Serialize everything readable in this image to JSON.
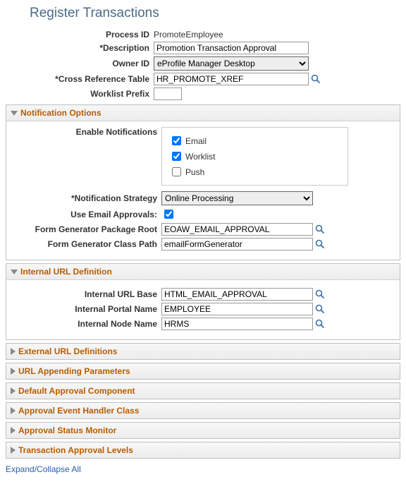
{
  "page_title": "Register Transactions",
  "top": {
    "process_id_label": "Process ID",
    "process_id_value": "PromoteEmployee",
    "description_label": "*Description",
    "description_value": "Promotion Transaction Approval",
    "owner_id_label": "Owner ID",
    "owner_id_value": "eProfile Manager Desktop",
    "xref_label": "*Cross Reference Table",
    "xref_value": "HR_PROMOTE_XREF",
    "worklist_prefix_label": "Worklist Prefix",
    "worklist_prefix_value": ""
  },
  "sections": {
    "notification": {
      "title": "Notification Options",
      "enable_label": "Enable Notifications",
      "email_label": "Email",
      "worklist_label": "Worklist",
      "push_label": "Push",
      "strategy_label": "*Notification Strategy",
      "strategy_value": "Online Processing",
      "use_email_label": "Use Email Approvals:",
      "pkg_root_label": "Form Generator Package Root",
      "pkg_root_value": "EOAW_EMAIL_APPROVAL",
      "class_path_label": "Form Generator Class Path",
      "class_path_value": "emailFormGenerator"
    },
    "internal_url": {
      "title": "Internal URL Definition",
      "base_label": "Internal URL Base",
      "base_value": "HTML_EMAIL_APPROVAL",
      "portal_label": "Internal Portal Name",
      "portal_value": "EMPLOYEE",
      "node_label": "Internal Node Name",
      "node_value": "HRMS"
    },
    "external_url": {
      "title": "External URL Definitions"
    },
    "url_append": {
      "title": "URL Appending Parameters"
    },
    "default_approval": {
      "title": "Default Approval Component"
    },
    "event_handler": {
      "title": "Approval Event Handler Class"
    },
    "status_monitor": {
      "title": "Approval Status Monitor"
    },
    "approval_levels": {
      "title": "Transaction Approval Levels"
    }
  },
  "expand_collapse": "Expand/Collapse All"
}
